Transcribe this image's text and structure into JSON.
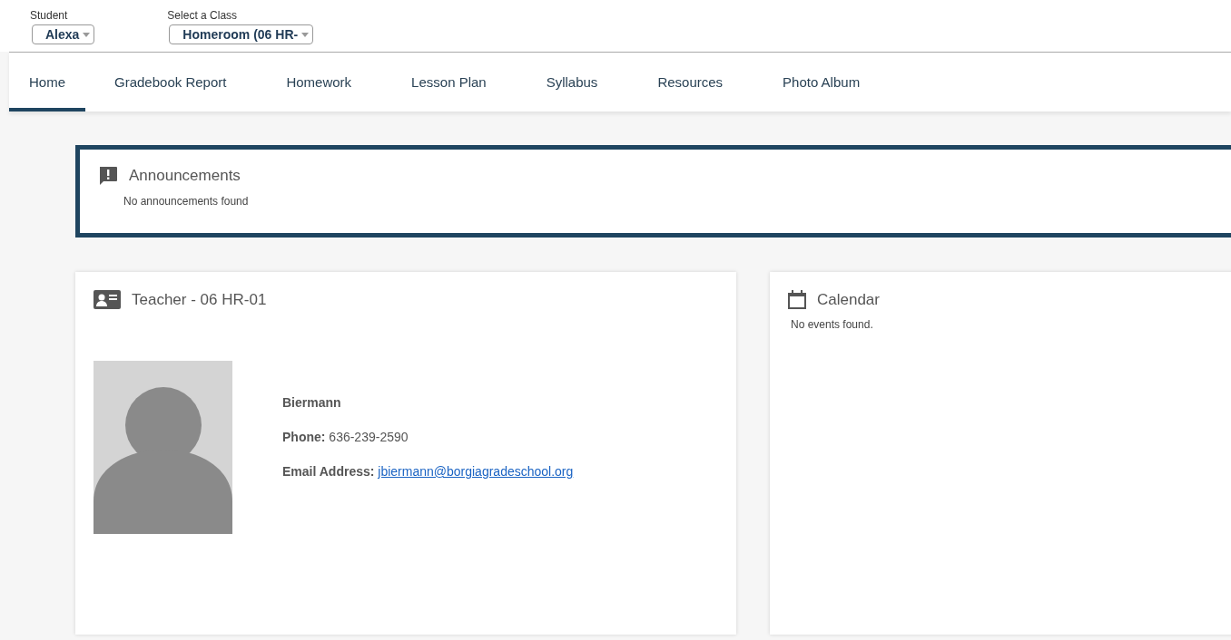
{
  "selectors": [
    {
      "label": "Student",
      "value": "Alexa"
    },
    {
      "label": "Select a Class",
      "value": "Homeroom (06 HR-"
    }
  ],
  "tabs": [
    {
      "label": "Home",
      "selected": true
    },
    {
      "label": "Gradebook Report",
      "selected": false
    },
    {
      "label": "Homework",
      "selected": false
    },
    {
      "label": "Lesson Plan",
      "selected": false
    },
    {
      "label": "Syllabus",
      "selected": false
    },
    {
      "label": "Resources",
      "selected": false
    },
    {
      "label": "Photo Album",
      "selected": false
    }
  ],
  "announcements": {
    "title": "Announcements",
    "message": "No announcements found"
  },
  "teacher": {
    "title": "Teacher - 06 HR-01",
    "name": "Biermann",
    "phone_label": "Phone:",
    "phone": "636-239-2590",
    "email_label": "Email Address:",
    "email": "jbiermann@borgiagradeschool.org"
  },
  "calendar": {
    "title": "Calendar",
    "message": "No events found."
  }
}
